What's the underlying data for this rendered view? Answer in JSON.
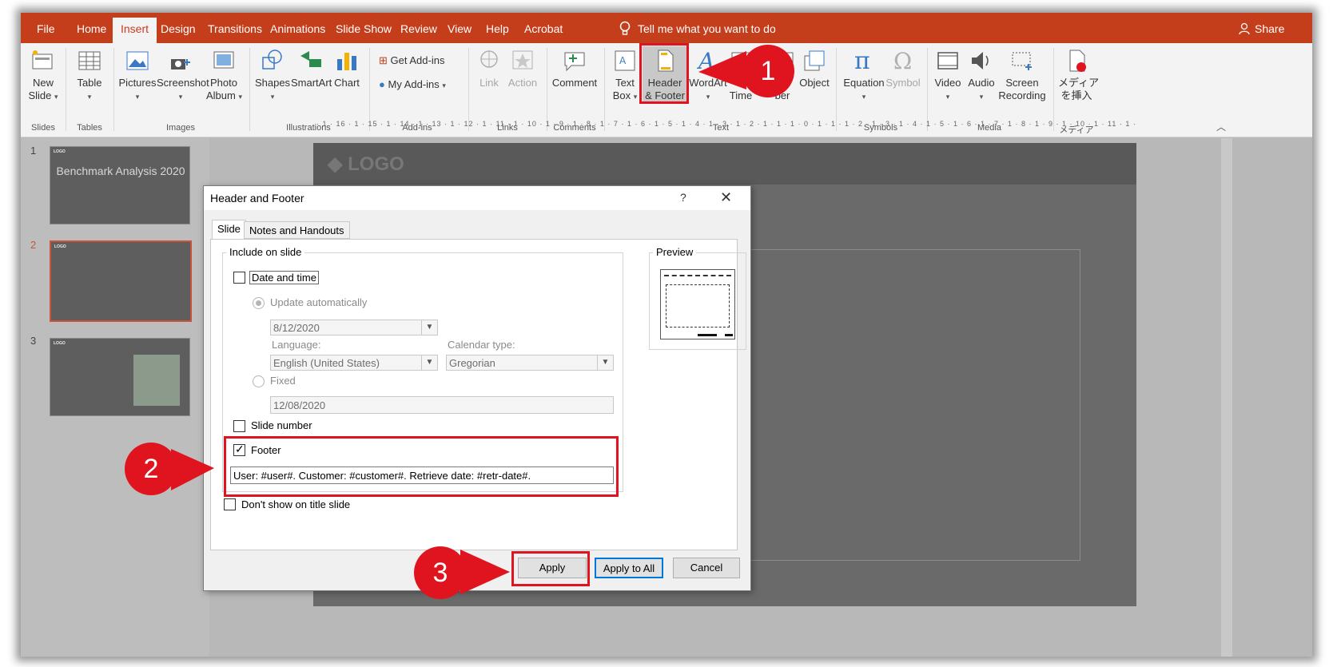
{
  "menu": {
    "file": "File",
    "tabs": [
      "Home",
      "Insert",
      "Design",
      "Transitions",
      "Animations",
      "Slide Show",
      "Review",
      "View",
      "Help",
      "Acrobat"
    ],
    "active_tab": "Insert",
    "tell_me": "Tell me what you want to do",
    "share": "Share"
  },
  "ribbon": {
    "slides": {
      "new_slide": "New",
      "new_slide_2": "Slide",
      "group": "Slides"
    },
    "tables": {
      "table": "Table",
      "group": "Tables"
    },
    "images": {
      "pictures": "Pictures",
      "screenshot": "Screenshot",
      "photo_album": "Photo",
      "photo_album_2": "Album",
      "group": "Images"
    },
    "illustrations": {
      "shapes": "Shapes",
      "smartart": "SmartArt",
      "chart": "Chart",
      "group": "Illustrations"
    },
    "addins": {
      "get": "Get Add-ins",
      "my": "My Add-ins",
      "group": "Add-ins"
    },
    "links": {
      "link": "Link",
      "action": "Action",
      "group": "Links"
    },
    "comments": {
      "comment": "Comment",
      "group": "Comments"
    },
    "text": {
      "textbox": "Text",
      "textbox_2": "Box",
      "header_footer": "Header",
      "header_footer_2": "& Footer",
      "wordart": "WordArt",
      "date_time": "Time",
      "slide_number": "ber",
      "object": "Object",
      "group": "Text"
    },
    "symbols": {
      "equation": "Equation",
      "symbol": "Symbol",
      "group": "Symbols"
    },
    "media": {
      "video": "Video",
      "audio": "Audio",
      "screen_recording": "Screen",
      "screen_recording_2": "Recording",
      "group": "Media"
    },
    "acrobat": {
      "insert_media": "メディア",
      "insert_media_2": "を挿入",
      "group": "メディア"
    }
  },
  "thumbnails": [
    {
      "num": "1",
      "title": "Benchmark Analysis 2020",
      "logo": "LOGO"
    },
    {
      "num": "2",
      "logo": "LOGO"
    },
    {
      "num": "3",
      "logo": "LOGO"
    }
  ],
  "ruler": "· 1 · 16 · 1 · 15 · 1 · 14 · 1 · 13 · 1 · 12 · 1 · 11 · 1 · 10 · 1 · 9 · 1 · 8 · 1 · 7 · 1 · 6 · 1 · 5 · 1 · 4 · 1 · 3 · 1 · 2 · 1 · 1 · 1 · 0 · 1 · 1 · 1 · 2 · 1 · 3 · 1 · 4 · 1 · 5 · 1 · 6 · 1 · 7 · 1 · 8 · 1 · 9 · 1 · 10 · 1 · 11 · 1 · 12 · 1 · 13 · 1 · 14 · 1 · 15 · 1 · 16 ·",
  "slide": {
    "logo": "LOGO"
  },
  "dialog": {
    "title": "Header and Footer",
    "help": "?",
    "close": "✕",
    "tabs": [
      "Slide",
      "Notes and Handouts"
    ],
    "include_legend": "Include on slide",
    "date_time": "Date and time",
    "update_auto": "Update automatically",
    "date_value": "8/12/2020",
    "language_label": "Language:",
    "language_value": "English (United States)",
    "calendar_label": "Calendar type:",
    "calendar_value": "Gregorian",
    "fixed": "Fixed",
    "fixed_value": "12/08/2020",
    "slide_number": "Slide number",
    "footer": "Footer",
    "footer_value": "User: #user#. Customer: #customer#. Retrieve date: #retr-date#.",
    "dont_show": "Don't show on title slide",
    "preview": "Preview",
    "apply": "Apply",
    "apply_all": "Apply to All",
    "cancel": "Cancel"
  },
  "markers": [
    "1",
    "2",
    "3"
  ],
  "colors": {
    "accent": "#c43e1c",
    "highlight": "#e0141f",
    "default_button": "#0078d7"
  }
}
